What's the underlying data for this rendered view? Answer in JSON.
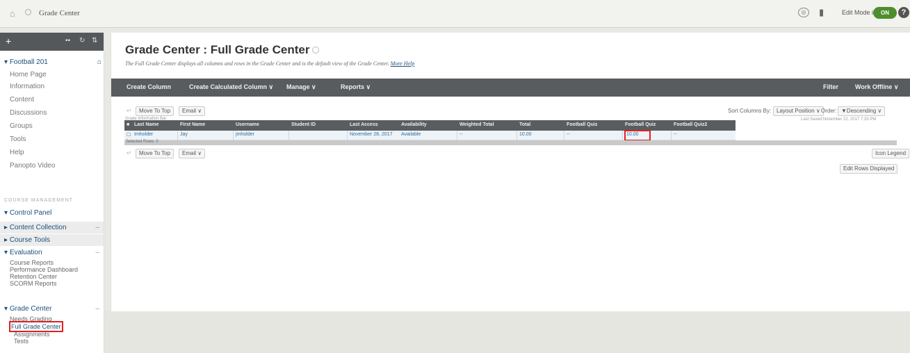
{
  "topbar": {
    "breadcrumb": "Grade Center",
    "edit_mode": "Edit Mode is",
    "toggle": "ON",
    "help": "?"
  },
  "sidebar": {
    "course": "Football 201",
    "links": [
      "Home Page",
      "Information",
      "Content",
      "Discussions",
      "Groups",
      "Tools",
      "Help",
      "Panopto Video"
    ],
    "management_label": "COURSE MANAGEMENT",
    "control_panel": "Control Panel",
    "content_collection": "Content Collection",
    "course_tools": "Course Tools",
    "evaluation": "Evaluation",
    "evaluation_items": [
      "Course Reports",
      "Performance Dashboard",
      "Retention Center",
      "SCORM Reports"
    ],
    "grade_center": "Grade Center",
    "grade_center_items": [
      "Needs Grading",
      "Full Grade Center",
      "Assignments",
      "Tests"
    ]
  },
  "main": {
    "title": "Grade Center : Full Grade Center",
    "description": "The Full Grade Center displays all columns and rows in the Grade Center and is the default view of the Grade Center.",
    "more_help": "More Help",
    "actions": [
      "Create Column",
      "Create Calculated Column ∨",
      "Manage ∨",
      "Reports ∨"
    ],
    "actions_right": [
      "Filter",
      "Work Offline ∨"
    ],
    "move_to_top": "Move To Top",
    "email": "Email ∨",
    "grade_info_bar": "Grade Information Bar",
    "sort_columns_by": "Sort Columns By:",
    "layout_position": "Layout Position ∨",
    "order": "Order:",
    "descending": "▼Descending ∨",
    "last_saved": "Last Saved:November 22, 2017 7:33 PM",
    "selected_rows": "Selected Rows: 0",
    "icon_legend": "Icon Legend",
    "edit_rows_displayed": "Edit Rows Displayed"
  },
  "grid": {
    "columns": [
      "Last Name",
      "First Name",
      "Username",
      "Student ID",
      "Last Access",
      "Availability",
      "Weighted Total",
      "Total",
      "Football Quiz",
      "Football Quiz",
      "Football Quiz2"
    ],
    "rows": [
      [
        "Imholder",
        "Jay",
        "jmholder",
        "",
        "November 28, 2017",
        "Available",
        "--",
        "10.00",
        "--",
        "10.00",
        "--"
      ]
    ]
  }
}
